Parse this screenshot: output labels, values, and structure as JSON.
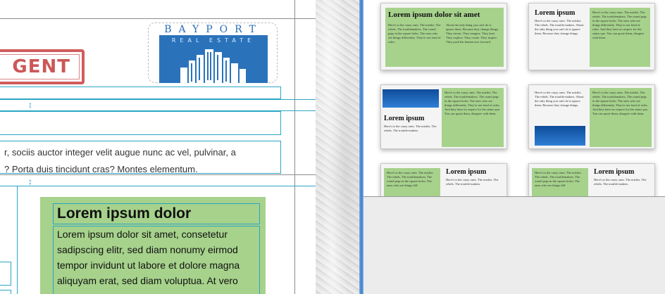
{
  "document": {
    "stamp_text": "GENT",
    "logo": {
      "name": "BAYPORT",
      "tagline": "REAL ESTATE"
    },
    "body_line_1": "r, sociis auctor integer velit augue nunc ac vel, pulvinar, a",
    "body_line_2": "? Porta duis tincidunt cras? Montes elementum.",
    "green_title": "Lorem ipsum dolor",
    "green_body": "Lorem ipsum dolor sit amet, consetetur sadipscing elitr, sed diam nonumy eirmod tempor invidunt ut labore et dolore magna aliquyam erat, sed diam voluptua. At vero"
  },
  "chooser": {
    "t1_title": "Lorem ipsum dolor sit amet",
    "t1_col_a": "Here's to the crazy ones. The misfits. The rebels. The troublemakers. The round pegs in the square holes. The ones who see things differently. They're not fond of rules.",
    "t1_col_b": "About the only thing you can't do is ignore them. Because they change things. They invent. They imagine. They heal. They explore. They create. They inspire. They push the human race forward.",
    "t2_title": "Lorem ipsum",
    "t2_text": "Here's to the crazy ones. The misfits. The rebels. The trouble-makers. About the only thing you can't do is ignore them. Because they change things.",
    "t2_green": "Here's to the crazy ones. The misfits. The rebels. The troublemakers. The round pegs in the square holes. The ones who see things differently. They're not fond of rules. And they have no respect for the status quo. You can quote them, disagree with them.",
    "t3_title": "Lorem ipsum",
    "t3_text": "Here's to the crazy ones. The misfits. The rebels. The trouble-makers.",
    "t3_green": "Here's to the crazy ones. The misfits. The rebels. The troublemakers. The round pegs in the square holes. The ones who see things differently. They're not fond of rules. And they have no respect for the status quo. You can quote them, disagree with them.",
    "t4_text": "Here's to the crazy ones. The misfits. The rebels. The trouble-makers. About the only thing you can't do is ignore them. Because they change things.",
    "t4_green": "Here's to the crazy ones. The misfits. The rebels. The troublemakers. The round pegs in the square holes. The ones who see things differently. They're not fond of rules. And they have no respect for the status quo. You can quote them, disagree with them.",
    "t5_title": "Lorem ipsum",
    "t5_text": "Here's to the crazy ones. The misfits. The rebels. The trouble-makers.",
    "t5_green": "Here's to the crazy ones. The misfits. The rebels. The troublemakers. The round pegs in the square holes. The ones who see things diff",
    "t6_title": "Lorem ipsum",
    "t6_text": "Here's to the crazy ones. The misfits. The rebels. The trouble-makers.",
    "t6_green": "Here's to the crazy ones. The misfits. The rebels. The troublemakers. The round pegs in the square holes. The ones who see things diff"
  },
  "colors": {
    "frame": "#2aa6c4",
    "green": "#a6d28c",
    "stamp": "#c94141",
    "logo_blue": "#2a73bb"
  }
}
